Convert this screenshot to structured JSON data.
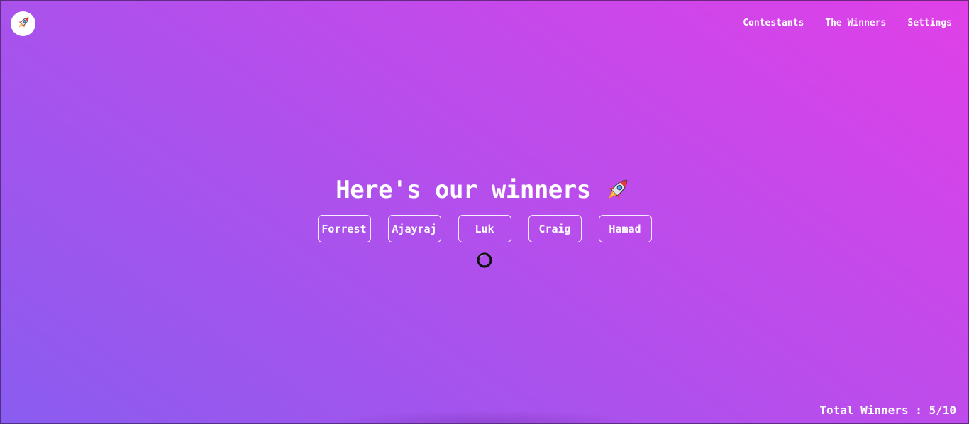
{
  "header": {
    "logo_icon": "rocket-icon",
    "nav": [
      {
        "label": "Contestants"
      },
      {
        "label": "The Winners"
      },
      {
        "label": "Settings"
      }
    ]
  },
  "main": {
    "title": "Here's our winners",
    "title_icon": "rocket-icon",
    "winners": [
      "Forrest",
      "Ajayraj",
      "Luk",
      "Craig",
      "Hamad"
    ],
    "loading_icon": "spinner-icon"
  },
  "footer": {
    "total_label": "Total Winners : 5/10"
  },
  "colors": {
    "gradient_start": "#8a5cf0",
    "gradient_mid": "#b050ec",
    "gradient_end": "#e040e8",
    "text": "#ffffff"
  }
}
